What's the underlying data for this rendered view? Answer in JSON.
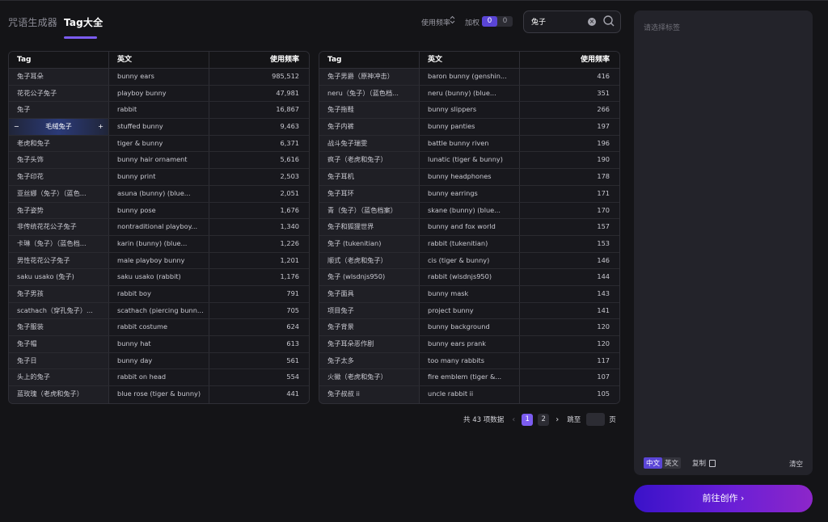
{
  "header": {
    "tab_inactive": "咒语生成器",
    "tab_active": "Tag大全",
    "sort_label": "使用频率",
    "sort_arrows": "⌃⌄",
    "weight_label": "加权",
    "weight_on": "0",
    "weight_off": "0",
    "search_value": "兔子",
    "clear_glyph": "×"
  },
  "table_headers": {
    "tag": "Tag",
    "en": "英文",
    "freq": "使用频率"
  },
  "left_table": [
    {
      "tag": "兔子耳朵",
      "en": "bunny ears",
      "freq": "985,512"
    },
    {
      "tag": "花花公子兔子",
      "en": "playboy bunny",
      "freq": "47,981"
    },
    {
      "tag": "兔子",
      "en": "rabbit",
      "freq": "16,867"
    },
    {
      "tag": "毛绒兔子",
      "en": "stuffed bunny",
      "freq": "9,463"
    },
    {
      "tag": "老虎和兔子",
      "en": "tiger & bunny",
      "freq": "6,371"
    },
    {
      "tag": "兔子头饰",
      "en": "bunny hair ornament",
      "freq": "5,616"
    },
    {
      "tag": "兔子印花",
      "en": "bunny print",
      "freq": "2,503"
    },
    {
      "tag": "亚丝娜（兔子）（蓝色...",
      "en": "asuna (bunny) (blue...",
      "freq": "2,051"
    },
    {
      "tag": "兔子姿势",
      "en": "bunny pose",
      "freq": "1,676"
    },
    {
      "tag": "非传统花花公子兔子",
      "en": "nontraditional playboy...",
      "freq": "1,340"
    },
    {
      "tag": "卡琳（兔子）（蓝色档...",
      "en": "karin (bunny) (blue...",
      "freq": "1,226"
    },
    {
      "tag": "男性花花公子兔子",
      "en": "male playboy bunny",
      "freq": "1,201"
    },
    {
      "tag": "saku usako (兔子)",
      "en": "saku usako (rabbit)",
      "freq": "1,176"
    },
    {
      "tag": "兔子男孩",
      "en": "rabbit boy",
      "freq": "791"
    },
    {
      "tag": "scathach（穿孔兔子）...",
      "en": "scathach (piercing bunn...",
      "freq": "705"
    },
    {
      "tag": "兔子服装",
      "en": "rabbit costume",
      "freq": "624"
    },
    {
      "tag": "兔子帽",
      "en": "bunny hat",
      "freq": "613"
    },
    {
      "tag": "兔子日",
      "en": "bunny day",
      "freq": "561"
    },
    {
      "tag": "头上的兔子",
      "en": "rabbit on head",
      "freq": "554"
    },
    {
      "tag": "蓝玫瑰（老虎和兔子）",
      "en": "blue rose (tiger & bunny)",
      "freq": "441"
    }
  ],
  "right_table": [
    {
      "tag": "兔子男爵（原神冲击）",
      "en": "baron bunny (genshin...",
      "freq": "416"
    },
    {
      "tag": "neru（兔子）（蓝色档...",
      "en": "neru (bunny) (blue...",
      "freq": "351"
    },
    {
      "tag": "兔子拖鞋",
      "en": "bunny slippers",
      "freq": "266"
    },
    {
      "tag": "兔子内裤",
      "en": "bunny panties",
      "freq": "197"
    },
    {
      "tag": "战斗兔子瑞雯",
      "en": "battle bunny riven",
      "freq": "196"
    },
    {
      "tag": "疯子（老虎和兔子）",
      "en": "lunatic (tiger & bunny)",
      "freq": "190"
    },
    {
      "tag": "兔子耳机",
      "en": "bunny headphones",
      "freq": "178"
    },
    {
      "tag": "兔子耳环",
      "en": "bunny earrings",
      "freq": "171"
    },
    {
      "tag": "青（兔子）（蓝色档案）",
      "en": "skane (bunny) (blue...",
      "freq": "170"
    },
    {
      "tag": "兔子和狐狸世界",
      "en": "bunny and fox world",
      "freq": "157"
    },
    {
      "tag": "兔子 (tukenitian)",
      "en": "rabbit (tukenitian)",
      "freq": "153"
    },
    {
      "tag": "顺式（老虎和兔子）",
      "en": "cis (tiger & bunny)",
      "freq": "146"
    },
    {
      "tag": "兔子 (wlsdnjs950)",
      "en": "rabbit (wlsdnjs950)",
      "freq": "144"
    },
    {
      "tag": "兔子面具",
      "en": "bunny mask",
      "freq": "143"
    },
    {
      "tag": "项目兔子",
      "en": "project bunny",
      "freq": "141"
    },
    {
      "tag": "兔子背景",
      "en": "bunny background",
      "freq": "120"
    },
    {
      "tag": "兔子耳朵恶作剧",
      "en": "bunny ears prank",
      "freq": "120"
    },
    {
      "tag": "兔子太多",
      "en": "too many rabbits",
      "freq": "117"
    },
    {
      "tag": "火徽（老虎和兔子）",
      "en": "fire emblem (tiger &...",
      "freq": "107"
    },
    {
      "tag": "兔子叔叔 ii",
      "en": "uncle rabbit ii",
      "freq": "105"
    }
  ],
  "highlight_row": {
    "minus": "−",
    "plus": "+"
  },
  "pager": {
    "total": "共 43 项数据",
    "prev": "‹",
    "next": "›",
    "page1": "1",
    "page2": "2",
    "goto": "跳至",
    "unit": "页"
  },
  "panel": {
    "placeholder": "请选择标签",
    "lang_cn": "中文",
    "lang_en": "英文",
    "copy": "复制",
    "clear": "清空"
  },
  "create_button": "前往创作 ›",
  "colors": {
    "accent": "#7b5cf0",
    "background": "#141417",
    "panel": "#23232a"
  }
}
